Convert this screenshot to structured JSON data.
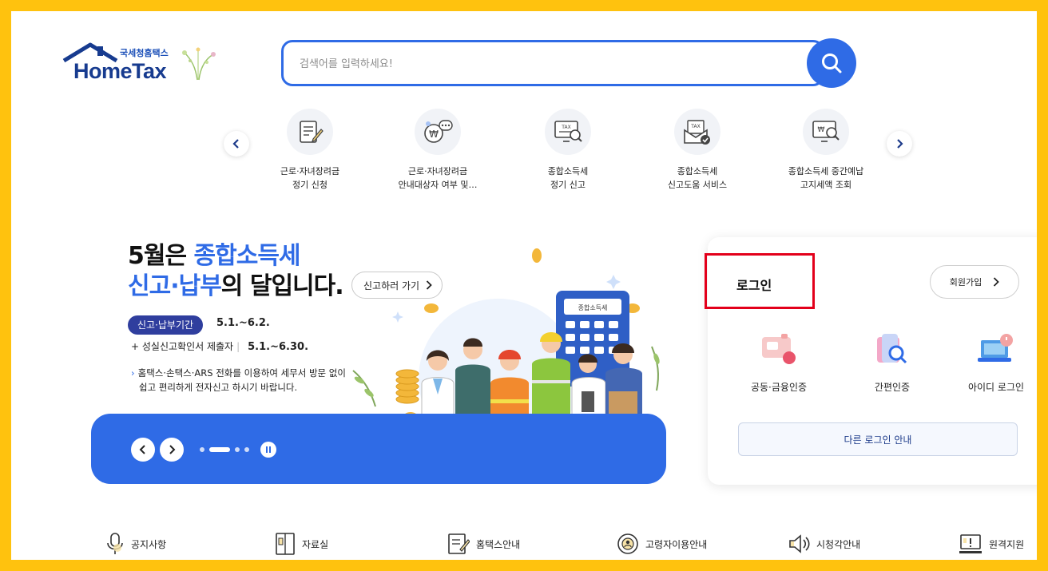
{
  "logo": {
    "subtitle": "국세청홈택스",
    "name": "HomeTax"
  },
  "search": {
    "placeholder": "검색어를 입력하세요!"
  },
  "quick_menu": [
    {
      "line1": "근로·자녀장려금",
      "line2": "정기 신청",
      "icon": "form-pen-icon"
    },
    {
      "line1": "근로·자녀장려금",
      "line2": "안내대상자 여부 및…",
      "icon": "won-chat-icon"
    },
    {
      "line1": "종합소득세",
      "line2": "정기 신고",
      "icon": "tax-monitor-icon"
    },
    {
      "line1": "종합소득세",
      "line2": "신고도움 서비스",
      "icon": "tax-envelope-check-icon"
    },
    {
      "line1": "종합소득세 중간예납",
      "line2": "고지세액 조회",
      "icon": "won-search-monitor-icon"
    }
  ],
  "hero": {
    "title_line1_a": "5월은 ",
    "title_line1_b": "종합소득세",
    "title_line2_a": "신고·납부",
    "title_line2_b": "의 달입니다.",
    "cta": "신고하러 가기",
    "badge": "신고·납부기간",
    "period": "5.1.~6.2.",
    "sub_label": "성실신고확인서 제출자",
    "sub_period": "5.1.~6.30.",
    "notice_line1": "홈택스·손택스·ARS 전화를 이용하여 세무서 방문 없이",
    "notice_line2": "쉽고 편리하게 전자신고 하시기 바랍니다.",
    "calculator_label": "종합소득세"
  },
  "login": {
    "title": "로그인",
    "join": "회원가입",
    "options": [
      {
        "label": "공동·금융인증",
        "icon": "certificate-card-icon"
      },
      {
        "label": "간편인증",
        "icon": "phone-search-icon"
      },
      {
        "label": "아이디 로그인",
        "icon": "laptop-power-icon"
      }
    ],
    "other": "다른 로그인 안내",
    "highlight_color": "#E3001B"
  },
  "bottom_nav": [
    {
      "label": "공지사항",
      "icon": "microphone-icon"
    },
    {
      "label": "자료실",
      "icon": "binder-icon"
    },
    {
      "label": "홈택스안내",
      "icon": "document-pen-icon"
    },
    {
      "label": "고령자이용안내",
      "icon": "senior-badge-icon"
    },
    {
      "label": "시청각안내",
      "icon": "speaker-icon"
    },
    {
      "label": "원격지원",
      "icon": "monitor-alert-icon"
    }
  ],
  "colors": {
    "accent": "#2F6BE6",
    "frame": "#FFC20E",
    "navy": "#2F3E9E"
  }
}
